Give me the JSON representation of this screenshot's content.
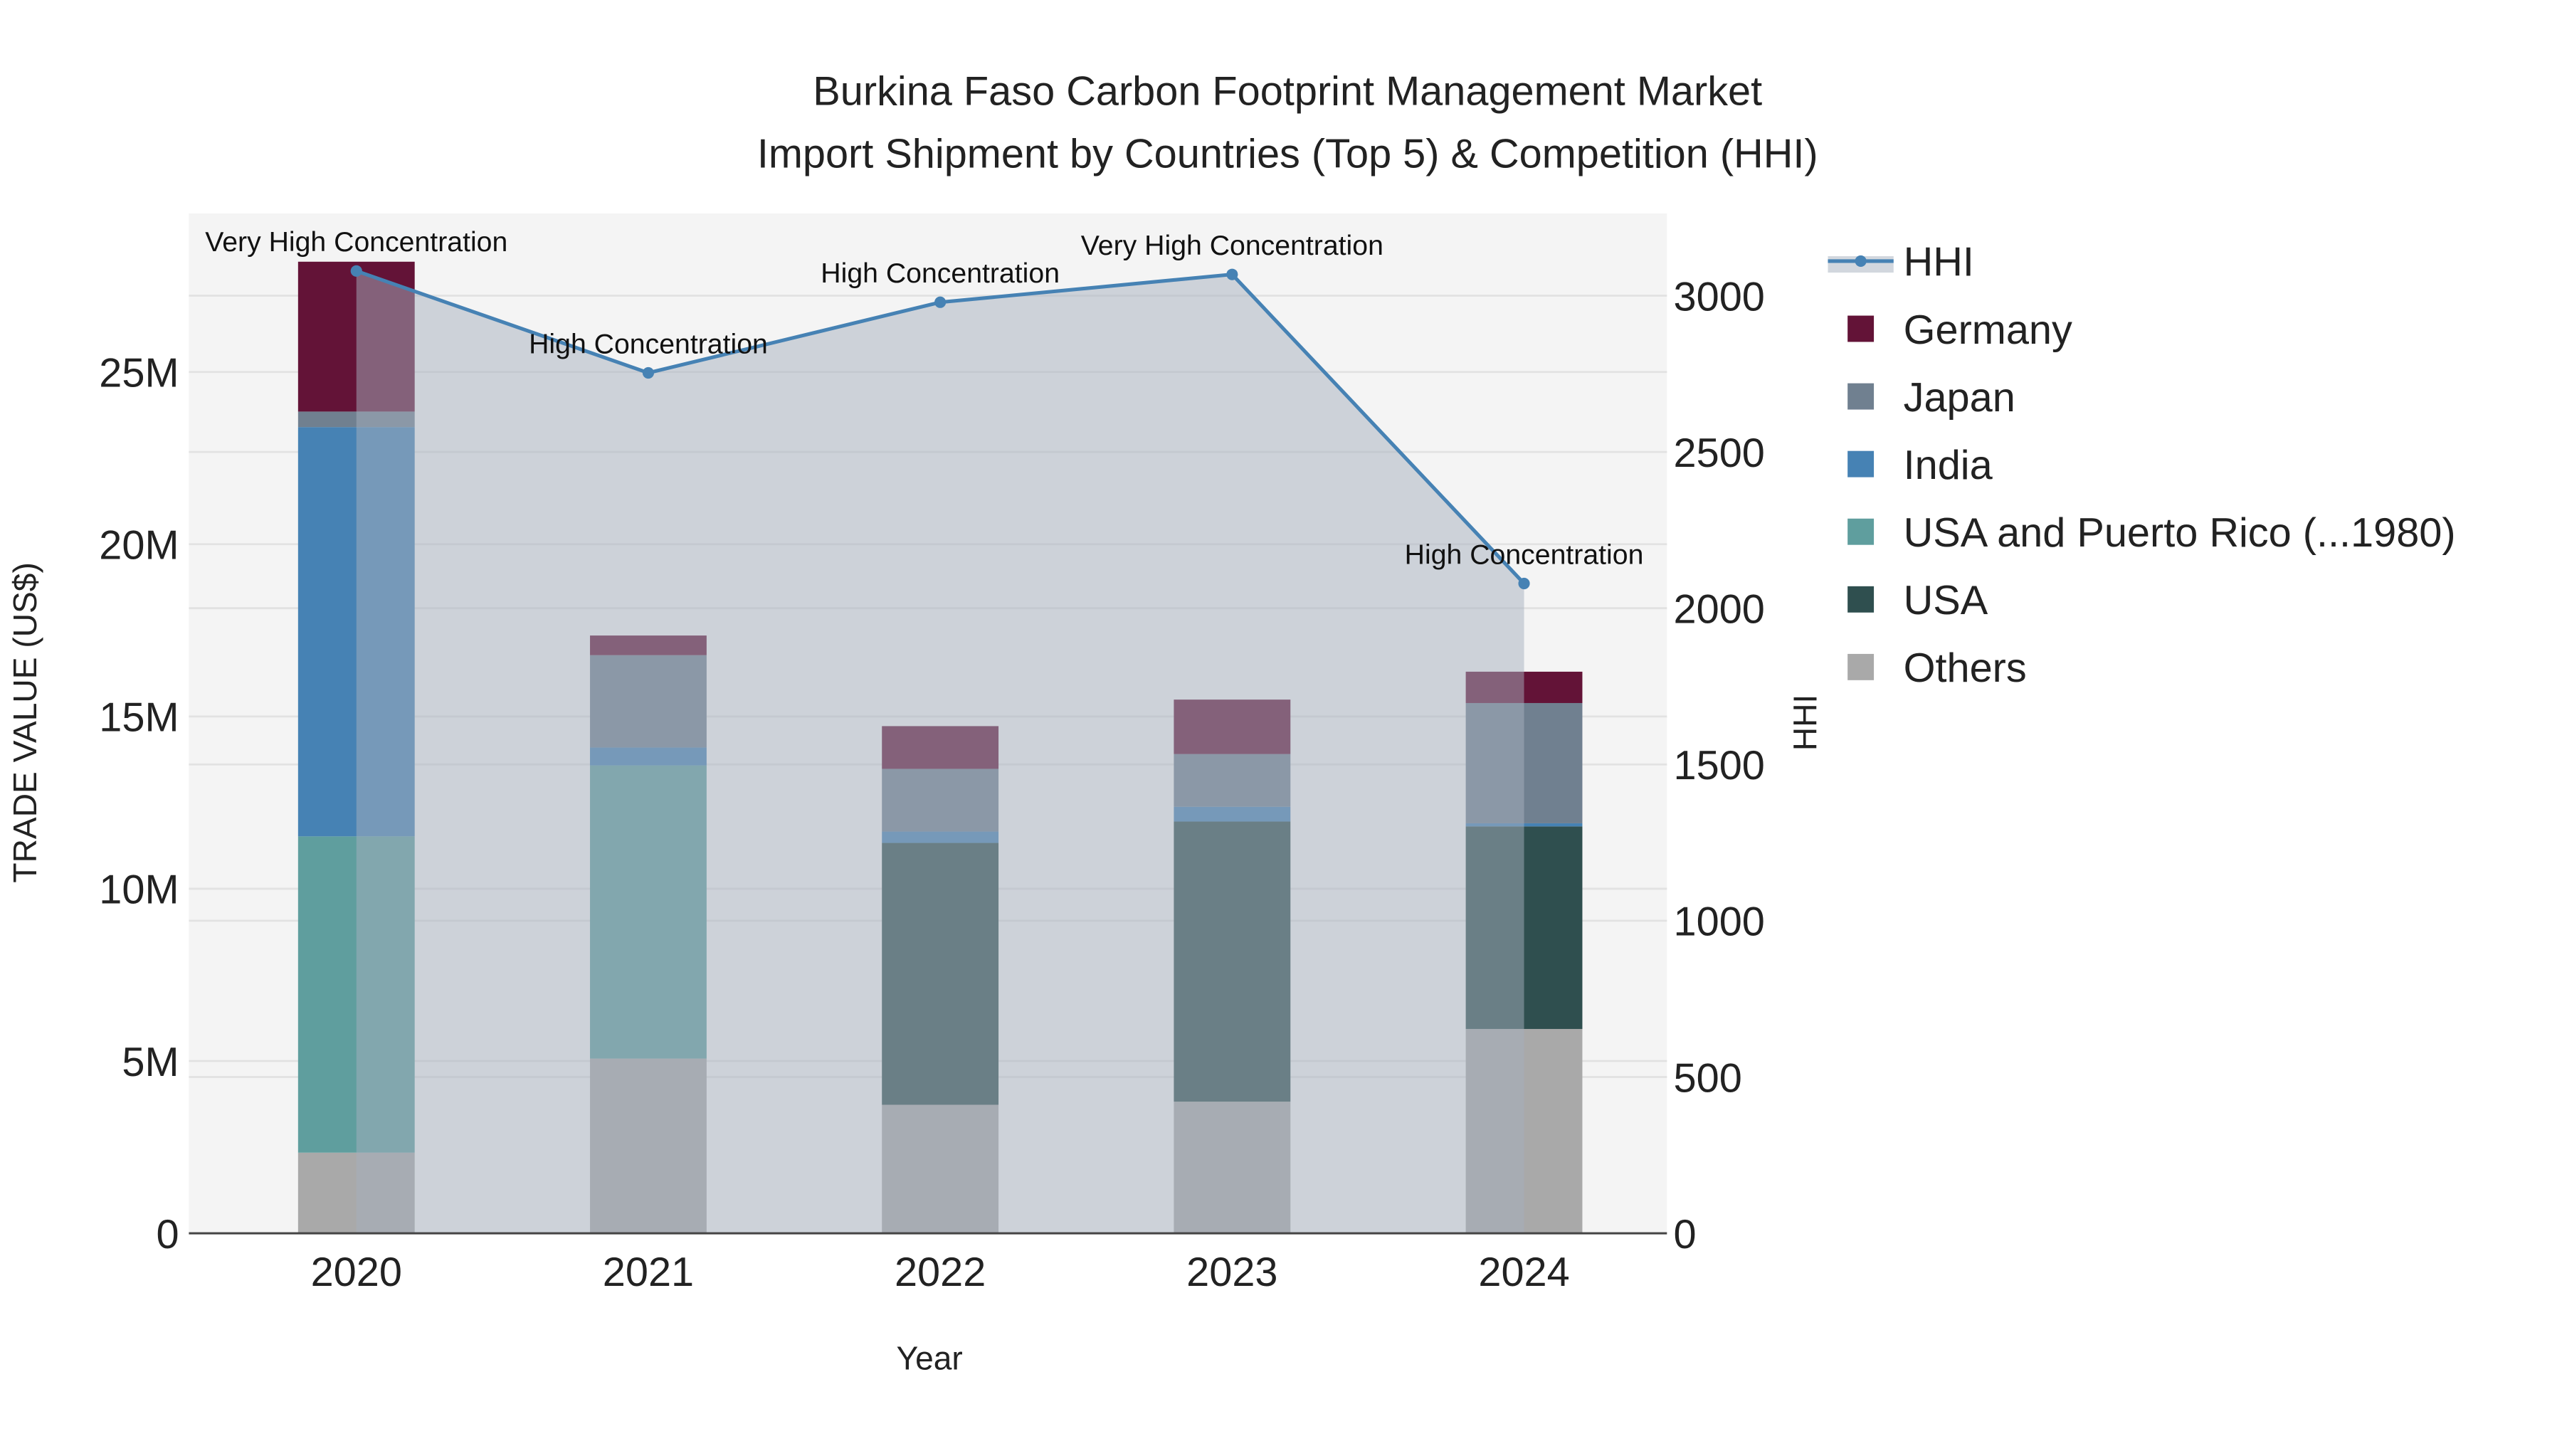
{
  "chart_data": {
    "type": "bar",
    "stacked": true,
    "title_line1": "Burkina Faso Carbon Footprint Management Market",
    "title_line2": "Import Shipment by Countries (Top 5) & Competition (HHI)",
    "xlabel": "Year",
    "ylabel": "TRADE VALUE (US$)",
    "y2label": "HHI",
    "categories": [
      "2020",
      "2021",
      "2022",
      "2023",
      "2024"
    ],
    "ylim": [
      0,
      29.6
    ],
    "yunit": "M",
    "yticks": [
      0,
      5,
      10,
      15,
      20,
      25
    ],
    "ytick_labels": [
      "0",
      "5M",
      "10M",
      "15M",
      "20M",
      "25M"
    ],
    "y2lim": [
      0,
      3263
    ],
    "y2ticks": [
      0,
      500,
      1000,
      1500,
      2000,
      2500,
      3000
    ],
    "y2tick_labels": [
      "0",
      "500",
      "1000",
      "1500",
      "2000",
      "2500",
      "3000"
    ],
    "series": [
      {
        "name": "Others",
        "color": "#a9a9a9",
        "values": [
          2.34,
          5.07,
          3.73,
          3.82,
          5.93
        ]
      },
      {
        "name": "USA",
        "color": "#2f4f4f",
        "values": [
          0,
          0,
          7.6,
          8.13,
          5.88
        ]
      },
      {
        "name": "USA and Puerto Rico (...1980)",
        "color": "#5f9e9e",
        "values": [
          9.18,
          8.51,
          0,
          0,
          0
        ]
      },
      {
        "name": "India",
        "color": "#4682b4",
        "values": [
          11.88,
          0.52,
          0.33,
          0.43,
          0.09
        ]
      },
      {
        "name": "Japan",
        "color": "#708090",
        "values": [
          0.45,
          2.68,
          1.82,
          1.53,
          3.49
        ]
      },
      {
        "name": "Germany",
        "color": "#631337",
        "values": [
          4.35,
          0.57,
          1.24,
          1.58,
          0.91
        ]
      }
    ],
    "hhi": {
      "name": "HHI",
      "color": "#4682b4",
      "values": [
        3079,
        2753,
        2979,
        3068,
        2079
      ],
      "annotations": [
        "Very High Concentration",
        "High Concentration",
        "High Concentration",
        "Very High Concentration",
        "High Concentration"
      ]
    },
    "legend_order": [
      "HHI",
      "Germany",
      "Japan",
      "India",
      "USA and Puerto Rico (...1980)",
      "USA",
      "Others"
    ],
    "legend_position": "right",
    "grid": true
  }
}
